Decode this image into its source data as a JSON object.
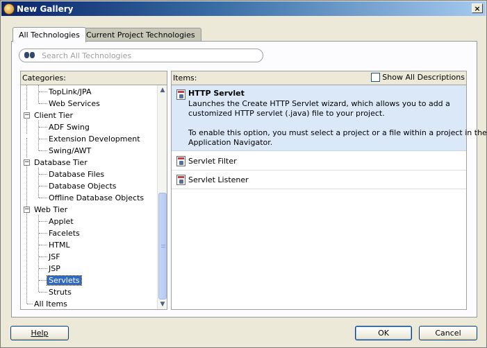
{
  "window": {
    "title": "New Gallery",
    "close_glyph": "×"
  },
  "tabs": [
    {
      "label": "All Technologies",
      "active": true
    },
    {
      "label": "Current Project Technologies",
      "active": false
    }
  ],
  "search": {
    "placeholder": "Search All Technologies",
    "value": ""
  },
  "categories": {
    "header": "Categories:",
    "items": [
      {
        "label": "TopLink/JPA",
        "level": 1
      },
      {
        "label": "Web Services",
        "level": 1
      },
      {
        "label": "Client Tier",
        "level": 0,
        "expanded": true
      },
      {
        "label": "ADF Swing",
        "level": 1
      },
      {
        "label": "Extension Development",
        "level": 1
      },
      {
        "label": "Swing/AWT",
        "level": 1
      },
      {
        "label": "Database Tier",
        "level": 0,
        "expanded": true
      },
      {
        "label": "Database Files",
        "level": 1
      },
      {
        "label": "Database Objects",
        "level": 1
      },
      {
        "label": "Offline Database Objects",
        "level": 1
      },
      {
        "label": "Web Tier",
        "level": 0,
        "expanded": true
      },
      {
        "label": "Applet",
        "level": 1
      },
      {
        "label": "Facelets",
        "level": 1
      },
      {
        "label": "HTML",
        "level": 1
      },
      {
        "label": "JSF",
        "level": 1
      },
      {
        "label": "JSP",
        "level": 1
      },
      {
        "label": "Servlets",
        "level": 1,
        "selected": true
      },
      {
        "label": "Struts",
        "level": 1
      },
      {
        "label": "All Items",
        "level": 0
      }
    ]
  },
  "items": {
    "header": "Items:",
    "show_all_label": "Show All Descriptions",
    "selected": {
      "title": "HTTP Servlet",
      "desc1": "Launches the Create HTTP Servlet wizard, which allows you to add a",
      "desc2": "customized HTTP servlet (.java) file to your project.",
      "desc3": "To enable this option, you must select a project or a file within a project in the",
      "desc4": "Application Navigator."
    },
    "list": [
      {
        "label": "Servlet Filter"
      },
      {
        "label": "Servlet Listener"
      }
    ]
  },
  "buttons": {
    "help": "Help",
    "ok": "OK",
    "cancel": "Cancel"
  }
}
